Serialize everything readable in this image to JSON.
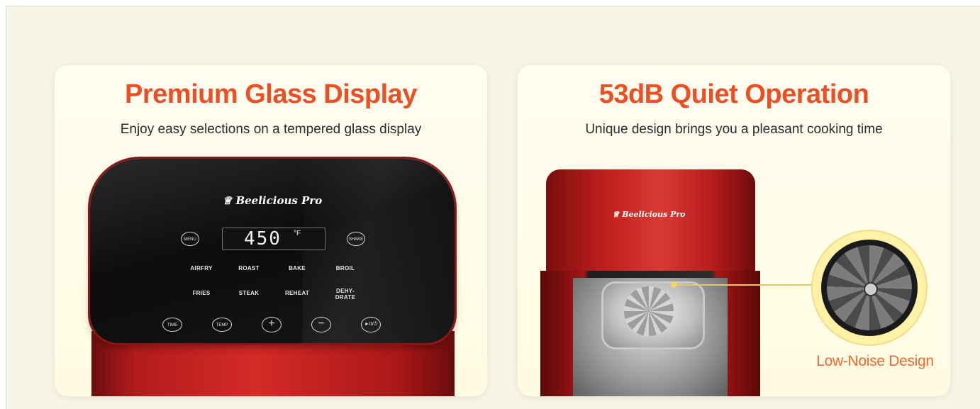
{
  "panels": [
    {
      "title": "Premium Glass Display",
      "subtitle": "Enjoy easy selections on a tempered glass display",
      "brand": "Beelicious Pro",
      "display": {
        "value": "450",
        "unit": "°F"
      },
      "buttons": {
        "menu": "MENU",
        "shake": "SHAKE",
        "time": "TIME",
        "temp": "TEMP",
        "plus": "+",
        "minus": "−",
        "start": "►II/⏻"
      },
      "modes_row1": [
        "AIRFRY",
        "ROAST",
        "BAKE",
        "BROIL"
      ],
      "modes_row2": [
        "FRIES",
        "STEAK",
        "REHEAT",
        "DEHY-DRATE"
      ]
    },
    {
      "title": "53dB Quiet Operation",
      "subtitle": "Unique design brings you a pleasant cooking time",
      "brand": "Beelicious Pro",
      "callout": "Low-Noise Design"
    }
  ],
  "colors": {
    "accent": "#ee4e21",
    "callout": "#ee6a2e",
    "background": "#f7f5e6"
  },
  "icons": [
    "chef-hat-icon",
    "fan-icon"
  ]
}
